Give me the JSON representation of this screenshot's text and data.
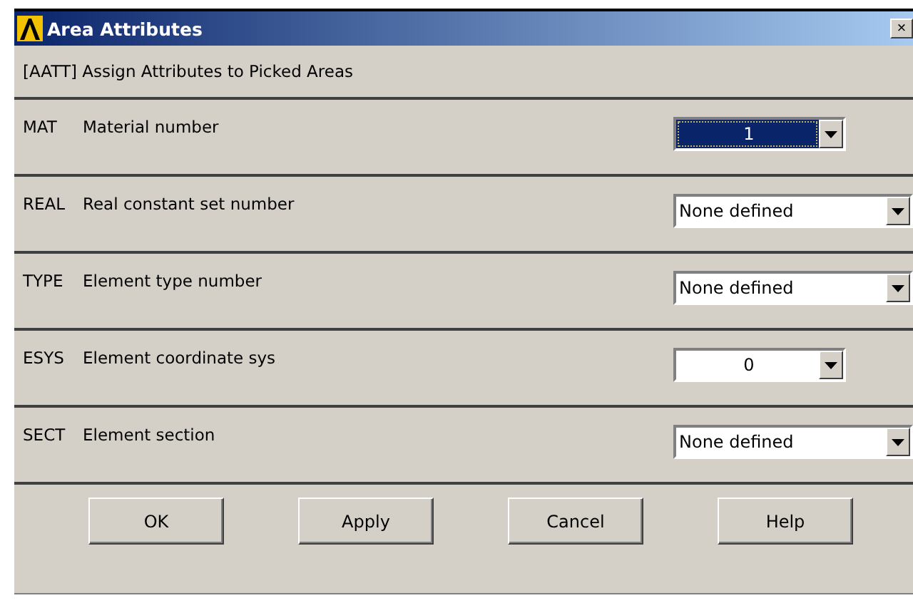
{
  "window": {
    "title": "Area Attributes",
    "close_glyph": "×"
  },
  "subtitle": "[AATT]  Assign Attributes to Picked Areas",
  "rows": [
    {
      "code": "MAT",
      "label": "Material number",
      "value": "1",
      "kind": "narrow",
      "selected": true
    },
    {
      "code": "REAL",
      "label": "Real constant set number",
      "value": "None defined",
      "kind": "wide",
      "selected": false
    },
    {
      "code": "TYPE",
      "label": "Element type number",
      "value": "None defined",
      "kind": "wide",
      "selected": false
    },
    {
      "code": "ESYS",
      "label": "Element coordinate sys",
      "value": "0",
      "kind": "narrow",
      "selected": false
    },
    {
      "code": "SECT",
      "label": "Element section",
      "value": "None defined",
      "kind": "wide",
      "selected": false
    }
  ],
  "buttons": [
    "OK",
    "Apply",
    "Cancel",
    "Help"
  ]
}
